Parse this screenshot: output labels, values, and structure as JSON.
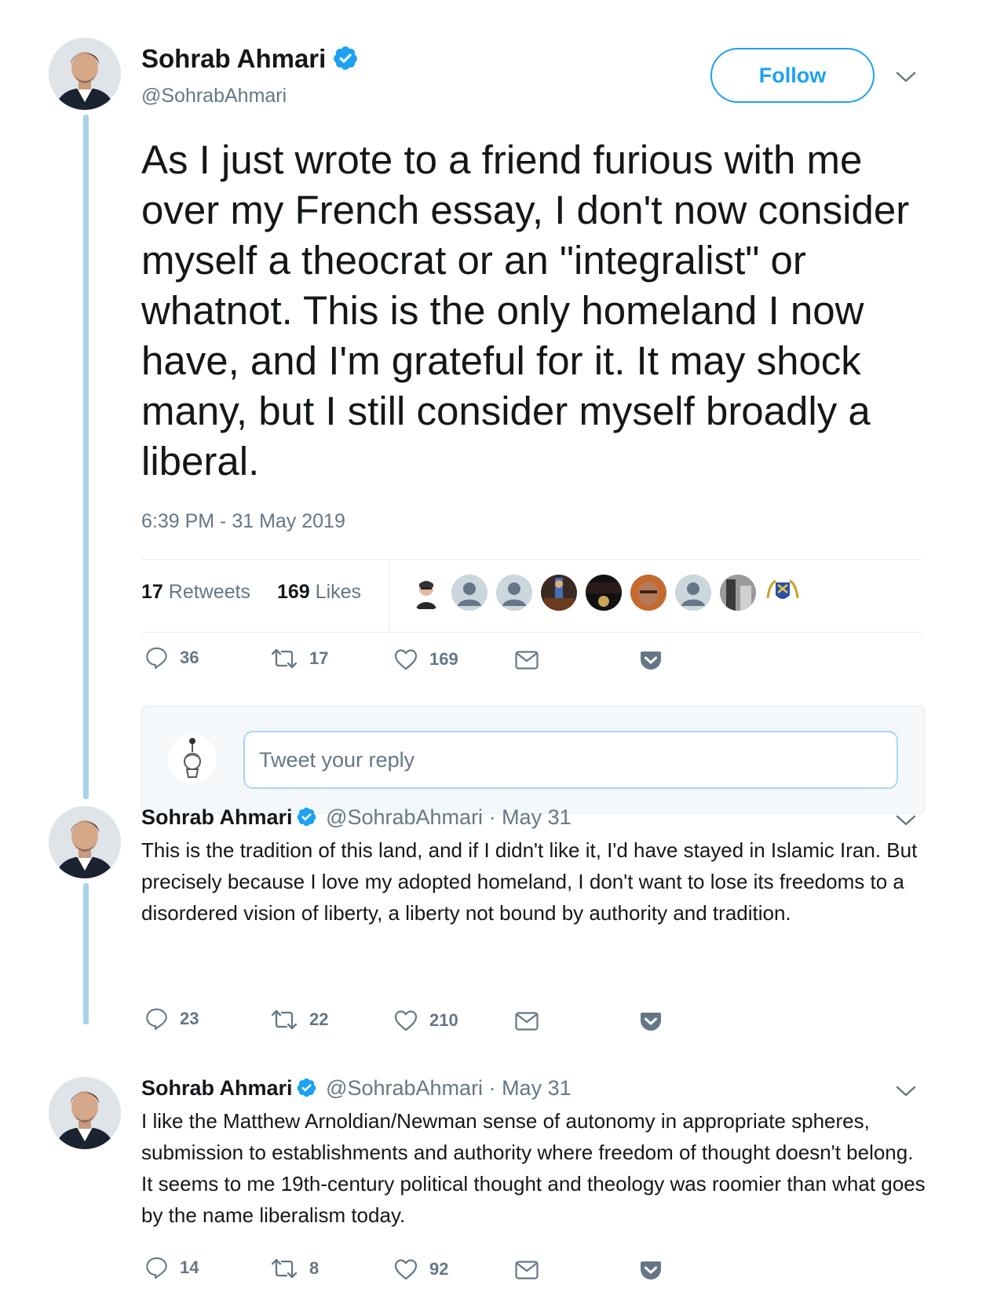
{
  "main_tweet": {
    "name": "Sohrab Ahmari",
    "handle": "@SohrabAhmari",
    "follow_label": "Follow",
    "text": "As I just wrote to a friend furious with me over my French essay, I don't now consider myself a theocrat or an \"integralist\" or whatnot. This is the only homeland I now have, and I'm grateful for it. It may shock many, but I still consider myself broadly a liberal.",
    "timestamp": "6:39 PM - 31 May 2019",
    "retweets_count": "17",
    "retweets_label": "Retweets",
    "likes_count": "169",
    "likes_label": "Likes",
    "actions": {
      "replies": "36",
      "retweets": "17",
      "likes": "169"
    }
  },
  "reply_box": {
    "placeholder": "Tweet your reply"
  },
  "replies": [
    {
      "name": "Sohrab Ahmari",
      "handle": "@SohrabAhmari",
      "date": "· May 31",
      "text": "This is the tradition of this land, and if I didn't like it, I'd have stayed in Islamic Iran. But precisely because I love my adopted homeland, I don't want to lose its freedoms to a disordered vision of liberty, a liberty not bound by authority and tradition.",
      "actions": {
        "replies": "23",
        "retweets": "22",
        "likes": "210"
      }
    },
    {
      "name": "Sohrab Ahmari",
      "handle": "@SohrabAhmari",
      "date": "· May 31",
      "text": "I like the Matthew Arnoldian/Newman sense of autonomy in appropriate spheres, submission to establishments and authority where freedom of thought doesn't belong. It seems to me 19th-century political thought and theology was roomier than what goes by the name liberalism today.",
      "actions": {
        "replies": "14",
        "retweets": "8",
        "likes": "92"
      }
    }
  ],
  "colors": {
    "accent": "#1da1f2",
    "thread_line": "#a7d3ea",
    "secondary_text": "#657786",
    "divider": "#e6ecf0"
  },
  "icons": [
    "verified-badge-icon",
    "chevron-down-icon",
    "reply-icon",
    "retweet-icon",
    "like-icon",
    "direct-message-icon",
    "tweet-activity-icon"
  ]
}
